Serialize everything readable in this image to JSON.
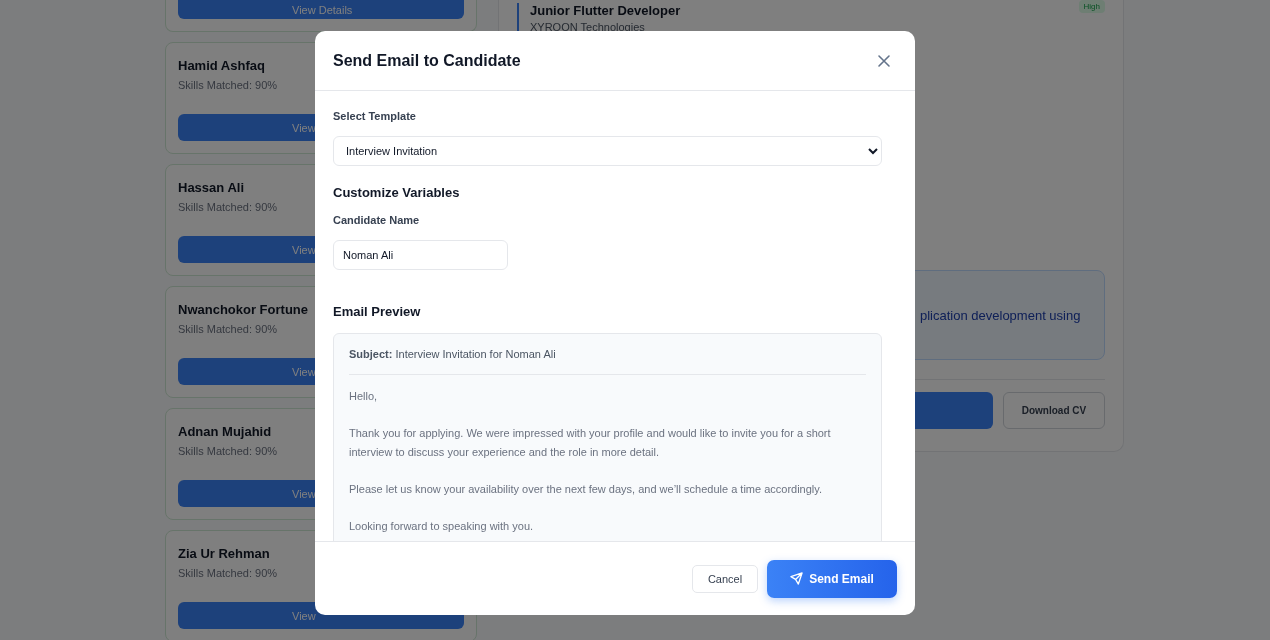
{
  "candidates": {
    "top_card": {
      "button": "View Details"
    },
    "items": [
      {
        "name": "Hamid Ashfaq",
        "skills": "Skills Matched: 90%",
        "button": "View"
      },
      {
        "name": "Hassan Ali",
        "skills": "Skills Matched: 90%",
        "button": "View"
      },
      {
        "name": "Nwanchokor Fortune",
        "skills": "Skills Matched: 90%",
        "button": "View"
      },
      {
        "name": "Adnan Mujahid",
        "skills": "Skills Matched: 90%",
        "button": "View"
      },
      {
        "name": "Zia Ur Rehman",
        "skills": "Skills Matched: 90%",
        "button": "View"
      }
    ]
  },
  "detail": {
    "job_title": "Junior Flutter Developer",
    "company": "XYROON Technologies",
    "priority": "High",
    "summary": "plication development using",
    "download_button": "Download CV"
  },
  "modal": {
    "title": "Send Email to Candidate",
    "template_label": "Select Template",
    "template_value": "Interview Invitation",
    "variables_heading": "Customize Variables",
    "name_label": "Candidate Name",
    "name_value": "Noman Ali",
    "preview_heading": "Email Preview",
    "subject_label": "Subject:",
    "subject": "Interview Invitation for Noman Ali",
    "paragraphs": [
      "Hello,",
      "Thank you for applying. We were impressed with your profile and would like to invite you for a short interview to discuss your experience and the role in more detail.",
      "Please let us know your availability over the next few days, and we’ll schedule a time accordingly.",
      "Looking forward to speaking with you."
    ],
    "cancel": "Cancel",
    "send": "Send Email"
  }
}
